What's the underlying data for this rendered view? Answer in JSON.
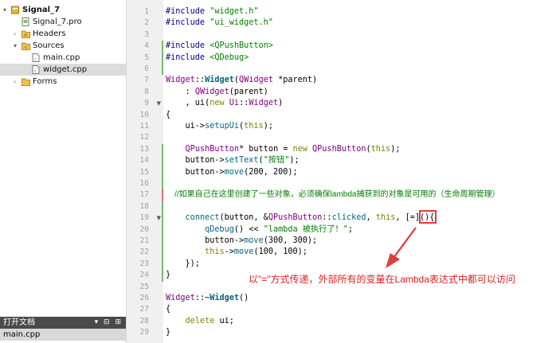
{
  "project_tree": [
    {
      "label": "Signal_7",
      "indent": 0,
      "twisty": "▾",
      "icon": "project-icon",
      "bold": true
    },
    {
      "label": "Signal_7.pro",
      "indent": 1,
      "twisty": "",
      "icon": "pro-file-icon"
    },
    {
      "label": "Headers",
      "indent": 1,
      "twisty": "›",
      "icon": "headers-folder-icon"
    },
    {
      "label": "Sources",
      "indent": 1,
      "twisty": "▾",
      "icon": "sources-folder-icon"
    },
    {
      "label": "main.cpp",
      "indent": 2,
      "twisty": "",
      "icon": "cpp-file-icon"
    },
    {
      "label": "widget.cpp",
      "indent": 2,
      "twisty": "",
      "icon": "cpp-file-icon",
      "selected": true
    },
    {
      "label": "Forms",
      "indent": 1,
      "twisty": "›",
      "icon": "forms-folder-icon"
    }
  ],
  "open_documents": {
    "title": "打开文档",
    "buttons": "▾ ⊟ ⊞",
    "items": [
      "main.cpp"
    ]
  },
  "editor": {
    "line_numbers": [
      "1",
      "2",
      "3",
      "4",
      "5",
      "6",
      "7",
      "8",
      "9",
      "10",
      "11",
      "12",
      "13",
      "14",
      "15",
      "16",
      "17",
      "18",
      "19",
      "20",
      "21",
      "22",
      "23",
      "24",
      "25",
      "26",
      "27",
      "28",
      "29"
    ]
  },
  "code_lines": [
    [
      {
        "t": "#include ",
        "c": "kw-pp"
      },
      {
        "t": "\"widget.h\"",
        "c": "str"
      }
    ],
    [
      {
        "t": "#include ",
        "c": "kw-pp"
      },
      {
        "t": "\"ui_widget.h\"",
        "c": "str"
      }
    ],
    [],
    [
      {
        "t": "#include ",
        "c": "kw-pp"
      },
      {
        "t": "<QPushButton>",
        "c": "str"
      }
    ],
    [
      {
        "t": "#include ",
        "c": "kw-pp"
      },
      {
        "t": "<QDebug>",
        "c": "str"
      }
    ],
    [],
    [
      {
        "t": "Widget",
        "c": "typ"
      },
      {
        "t": "::"
      },
      {
        "t": "Widget",
        "c": "fn bold"
      },
      {
        "t": "("
      },
      {
        "t": "QWidget",
        "c": "typ"
      },
      {
        "t": " *parent)"
      }
    ],
    [
      {
        "t": "    : "
      },
      {
        "t": "QWidget",
        "c": "typ"
      },
      {
        "t": "(parent)"
      }
    ],
    [
      {
        "t": "    , ui("
      },
      {
        "t": "new ",
        "c": "kw"
      },
      {
        "t": "Ui",
        "c": "typ"
      },
      {
        "t": "::"
      },
      {
        "t": "Widget",
        "c": "typ"
      },
      {
        "t": ")"
      }
    ],
    [
      {
        "t": "{"
      }
    ],
    [
      {
        "t": "    ui->"
      },
      {
        "t": "setupUi",
        "c": "fn"
      },
      {
        "t": "("
      },
      {
        "t": "this",
        "c": "kw"
      },
      {
        "t": ");"
      }
    ],
    [],
    [
      {
        "t": "    "
      },
      {
        "t": "QPushButton",
        "c": "typ"
      },
      {
        "t": "* button = "
      },
      {
        "t": "new ",
        "c": "kw"
      },
      {
        "t": "QPushButton",
        "c": "typ"
      },
      {
        "t": "("
      },
      {
        "t": "this",
        "c": "kw"
      },
      {
        "t": ");"
      }
    ],
    [
      {
        "t": "    button->"
      },
      {
        "t": "setText",
        "c": "fn"
      },
      {
        "t": "("
      },
      {
        "t": "\"按钮\"",
        "c": "str"
      },
      {
        "t": ");"
      }
    ],
    [
      {
        "t": "    button->"
      },
      {
        "t": "move",
        "c": "fn"
      },
      {
        "t": "(200, 200);"
      }
    ],
    [],
    [
      {
        "t": "    //如果自己在这里创建了一些对象，必须确保lambda捕获到的对象是可用的（生命周期管理）",
        "c": "cmt"
      }
    ],
    [],
    [
      {
        "t": "    "
      },
      {
        "t": "connect",
        "c": "fn"
      },
      {
        "t": "(button, &"
      },
      {
        "t": "QPushButton",
        "c": "typ"
      },
      {
        "t": "::"
      },
      {
        "t": "clicked",
        "c": "fn"
      },
      {
        "t": ", "
      },
      {
        "t": "this",
        "c": "kw"
      },
      {
        "t": ", [=](){"
      }
    ],
    [
      {
        "t": "        "
      },
      {
        "t": "qDebug",
        "c": "fn"
      },
      {
        "t": "() << "
      },
      {
        "t": "\"lambda 被执行了！\"",
        "c": "str"
      },
      {
        "t": ";"
      }
    ],
    [
      {
        "t": "        button->"
      },
      {
        "t": "move",
        "c": "fn"
      },
      {
        "t": "(300, 300);"
      }
    ],
    [
      {
        "t": "        "
      },
      {
        "t": "this",
        "c": "kw"
      },
      {
        "t": "->"
      },
      {
        "t": "move",
        "c": "fn"
      },
      {
        "t": "(100, 100);"
      }
    ],
    [
      {
        "t": "    });"
      }
    ],
    [
      {
        "t": "}"
      }
    ],
    [],
    [
      {
        "t": "Widget",
        "c": "typ"
      },
      {
        "t": "::~"
      },
      {
        "t": "Widget",
        "c": "fn bold"
      },
      {
        "t": "()"
      }
    ],
    [
      {
        "t": "{"
      }
    ],
    [
      {
        "t": "    "
      },
      {
        "t": "delete ",
        "c": "kw"
      },
      {
        "t": "ui;"
      }
    ],
    [
      {
        "t": "}"
      }
    ]
  ],
  "annotation": {
    "text": "以\"=\"方式传递，外部所有的变量在Lambda表达式中都可以访问",
    "color": "#e02020"
  }
}
